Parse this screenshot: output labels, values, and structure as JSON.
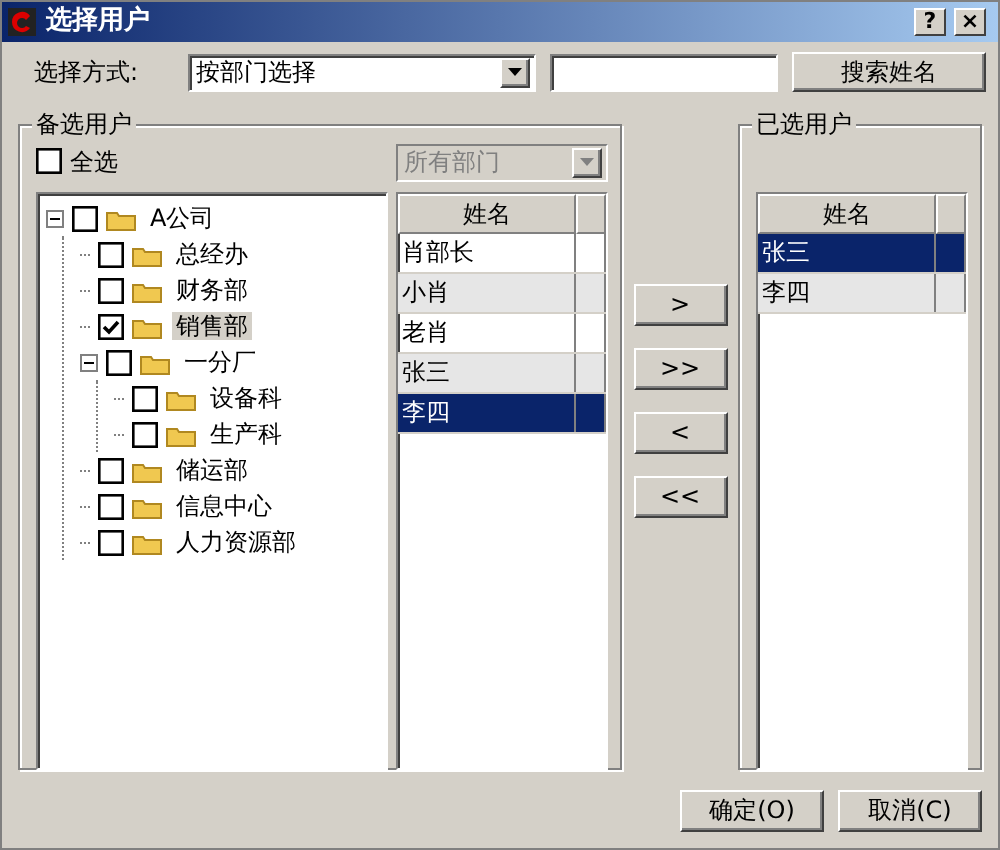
{
  "window": {
    "title": "选择用户",
    "help_button": "?",
    "close_button": "×"
  },
  "selection_mode": {
    "label": "选择方式:",
    "value": "按部门选择"
  },
  "search_button": "搜索姓名",
  "candidates": {
    "title": "备选用户",
    "select_all": {
      "label": "全选",
      "checked": false
    },
    "department_filter": {
      "value": "所有部门",
      "disabled": true
    },
    "tree": [
      {
        "label": "A公司",
        "checked": false,
        "selected": false,
        "expanded": true,
        "children": [
          {
            "label": "总经办",
            "checked": false,
            "selected": false
          },
          {
            "label": "财务部",
            "checked": false,
            "selected": false
          },
          {
            "label": "销售部",
            "checked": true,
            "selected": true
          },
          {
            "label": "一分厂",
            "checked": false,
            "selected": false,
            "expanded": true,
            "children": [
              {
                "label": "设备科",
                "checked": false,
                "selected": false
              },
              {
                "label": "生产科",
                "checked": false,
                "selected": false
              }
            ]
          },
          {
            "label": "储运部",
            "checked": false,
            "selected": false
          },
          {
            "label": "信息中心",
            "checked": false,
            "selected": false
          },
          {
            "label": "人力资源部",
            "checked": false,
            "selected": false
          }
        ]
      }
    ],
    "list": {
      "column": "姓名",
      "rows": [
        {
          "name": "肖部长",
          "selected": false
        },
        {
          "name": "小肖",
          "selected": false
        },
        {
          "name": "老肖",
          "selected": false
        },
        {
          "name": "张三",
          "selected": false
        },
        {
          "name": "李四",
          "selected": true
        }
      ]
    }
  },
  "transfer_buttons": [
    ">",
    ">>",
    "<",
    "<<"
  ],
  "chosen": {
    "title": "已选用户",
    "list": {
      "column": "姓名",
      "rows": [
        {
          "name": "张三",
          "selected": true
        },
        {
          "name": "李四",
          "selected": false
        }
      ]
    }
  },
  "buttons": [
    "确定(O)",
    "取消(C)"
  ]
}
